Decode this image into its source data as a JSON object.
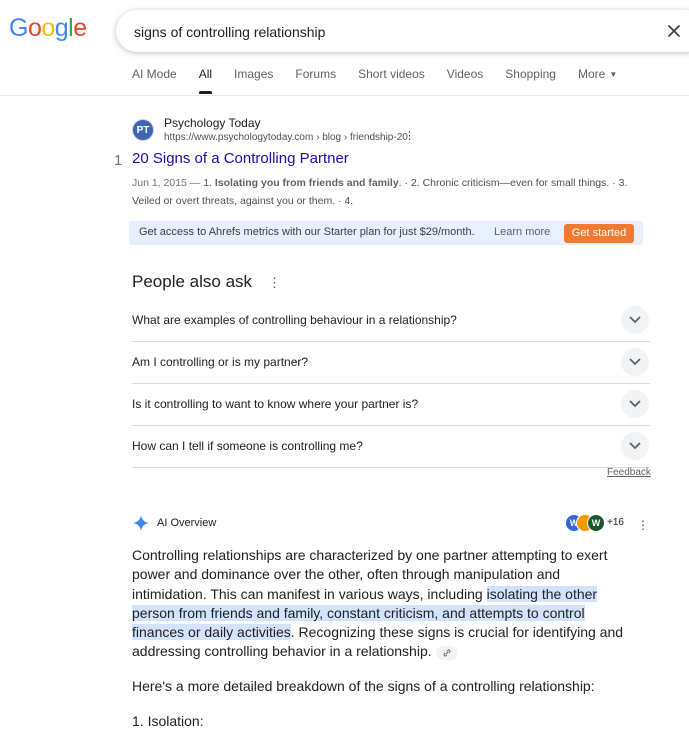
{
  "logo": {
    "letters": [
      "G",
      "o",
      "o",
      "g",
      "l",
      "e"
    ],
    "colors": [
      "#4285f4",
      "#ea4335",
      "#fbbc05",
      "#4285f4",
      "#34a853",
      "#ea4335"
    ]
  },
  "search": {
    "query": "signs of controlling relationship"
  },
  "tabs": [
    {
      "label": "AI Mode"
    },
    {
      "label": "All"
    },
    {
      "label": "Images"
    },
    {
      "label": "Forums"
    },
    {
      "label": "Short videos"
    },
    {
      "label": "Videos"
    },
    {
      "label": "Shopping"
    },
    {
      "label": "More"
    }
  ],
  "result": {
    "favicon_text": "PT",
    "site_name": "Psychology Today",
    "url": "https://www.psychologytoday.com › blog › friendship-20",
    "rank": "1",
    "title": "20 Signs of a Controlling Partner",
    "date": "Jun 1, 2015 —",
    "snippet_pre": " 1. ",
    "snippet_bold": "Isolating you from friends and family",
    "snippet_post": ". · 2. Chronic criticism—even for small things. · 3. Veiled or overt threats, against you or them. · 4."
  },
  "ahrefs": {
    "text": "Get access to Ahrefs metrics with our Starter plan for just $29/month.",
    "learn_more": "Learn more",
    "cta": "Get started",
    "accent": "#f27a30"
  },
  "paa": {
    "title": "People also ask",
    "questions": [
      "What are examples of controlling behaviour in a relationship?",
      "Am I controlling or is my partner?",
      "Is it controlling to want to know where your partner is?",
      "How can I tell if someone is controlling me?"
    ],
    "feedback": "Feedback"
  },
  "ai_overview": {
    "title": "AI Overview",
    "avatars": [
      "W",
      "",
      "W"
    ],
    "more_sources": "+16",
    "para1_a": "Controlling relationships are characterized by one partner attempting to exert power and dominance over the other, often through manipulation and intimidation. This can manifest in various ways, including ",
    "para1_highlight": "isolating the other person from friends and family, constant criticism, and attempts to control finances or daily activities",
    "para1_b": ". Recognizing these signs is crucial for identifying and addressing controlling behavior in a relationship.",
    "para2": "Here's a more detailed breakdown of the signs of a controlling relationship:",
    "list_item_1": "1. Isolation:"
  }
}
